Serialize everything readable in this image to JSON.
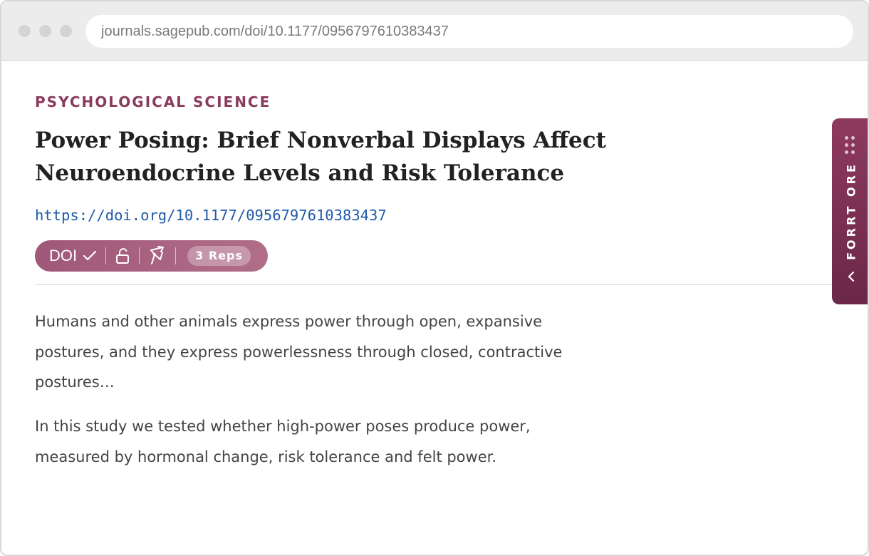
{
  "browser": {
    "url": "journals.sagepub.com/doi/10.1177/0956797610383437"
  },
  "article": {
    "journal": "PSYCHOLOGICAL SCIENCE",
    "title": "Power Posing: Brief Nonverbal Displays Affect Neuroendocrine Levels and Risk Tolerance",
    "doi_link": "https://doi.org/10.1177/0956797610383437",
    "abstract_paragraphs": [
      "Humans and other animals express power through open, expansive postures, and they express powerlessness through closed, contractive postures…",
      "In this study we tested whether high-power poses produce power, measured by hormonal change, risk tolerance and felt power."
    ]
  },
  "badge": {
    "doi_label": "DOI",
    "icons": [
      "check-icon",
      "open-lock-icon",
      "broken-arrow-icon"
    ],
    "reps_label": "3 Reps"
  },
  "sidebar_tab": {
    "label": "FORRT ORE",
    "icons": [
      "drag-grip-icon",
      "chevron-left-icon"
    ]
  },
  "colors": {
    "accent": "#8a3a5a",
    "badge": "#a05878",
    "tab": "#7a2f54",
    "link": "#1f5aa8"
  }
}
